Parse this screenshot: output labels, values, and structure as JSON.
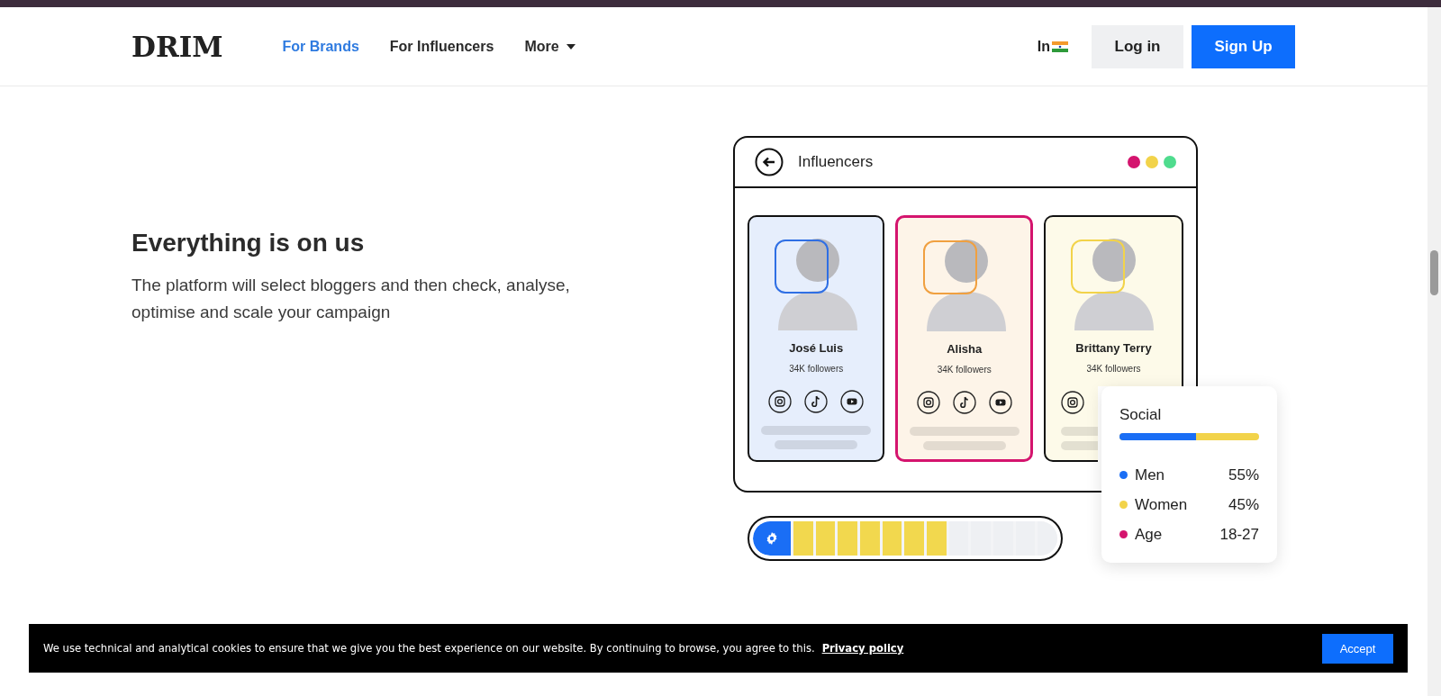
{
  "header": {
    "logo": "DRIM",
    "nav": [
      {
        "label": "For Brands",
        "kind": "link",
        "selected": true
      },
      {
        "label": "For Influencers",
        "kind": "link",
        "selected": false
      },
      {
        "label": "More",
        "kind": "dropdown",
        "selected": false
      }
    ],
    "language": "In",
    "login": "Log in",
    "signup": "Sign Up"
  },
  "hero": {
    "title": "Everything is on us",
    "text": "The platform will select bloggers and then check, analyse, optimise and scale your campaign"
  },
  "mockup": {
    "title": "Influencers",
    "window_dots": [
      {
        "color": "#d4146e"
      },
      {
        "color": "#f2d34a"
      },
      {
        "color": "#4fdc8e"
      }
    ],
    "cards": [
      {
        "name": "José Luis",
        "followers": "34K followers",
        "selected": false,
        "color": "#2f6fe4",
        "socials": [
          {
            "kind": "instagram"
          },
          {
            "kind": "tiktok"
          },
          {
            "kind": "youtube"
          }
        ]
      },
      {
        "name": "Alisha",
        "followers": "34K followers",
        "selected": true,
        "color": "#f0a040",
        "socials": [
          {
            "kind": "instagram"
          },
          {
            "kind": "tiktok"
          },
          {
            "kind": "youtube"
          }
        ]
      },
      {
        "name": "Brittany Terry",
        "followers": "34K followers",
        "selected": false,
        "color": "#f2d34a",
        "socials": [
          {
            "kind": "instagram"
          }
        ]
      }
    ],
    "social": {
      "title": "Social",
      "level": 0.55,
      "rows": [
        {
          "label": "Men",
          "value": "55%",
          "color": "#1a6ef5"
        },
        {
          "label": "Women",
          "value": "45%",
          "color": "#f2d34a"
        },
        {
          "label": "Age",
          "value": "18-27",
          "color": "#d4146e"
        }
      ]
    },
    "progress": {
      "level": 0.58
    }
  },
  "cookie": {
    "text": "We use technical and analytical cookies to ensure that we give you the best experience on our website. By continuing to browse, you agree to this.",
    "link": "Privacy policy",
    "button": "Accept"
  }
}
